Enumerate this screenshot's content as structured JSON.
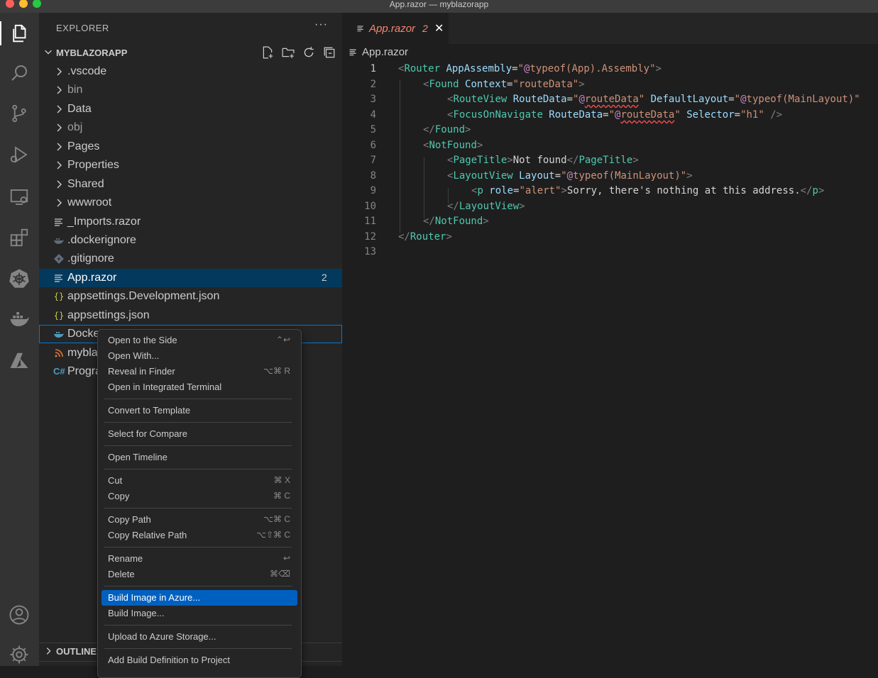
{
  "window": {
    "title": "App.razor — myblazorapp"
  },
  "explorer": {
    "title": "EXPLORER",
    "more": "···",
    "section_title": "MYBLAZORAPP",
    "items": [
      {
        "label": "vscode_dir",
        "text": ".vscode",
        "type": "folder"
      },
      {
        "label": "bin",
        "text": "bin",
        "type": "folder"
      },
      {
        "label": "data",
        "text": "Data",
        "type": "folder"
      },
      {
        "label": "obj",
        "text": "obj",
        "type": "folder"
      },
      {
        "label": "pages",
        "text": "Pages",
        "type": "folder"
      },
      {
        "label": "properties",
        "text": "Properties",
        "type": "folder"
      },
      {
        "label": "shared",
        "text": "Shared",
        "type": "folder"
      },
      {
        "label": "wwwroot",
        "text": "wwwroot",
        "type": "folder"
      },
      {
        "label": "imports",
        "text": "_Imports.razor",
        "type": "file"
      },
      {
        "label": "dockerignore",
        "text": ".dockerignore",
        "type": "file"
      },
      {
        "label": "gitignore",
        "text": ".gitignore",
        "type": "file"
      },
      {
        "label": "app",
        "text": "App.razor",
        "type": "file",
        "badge": "2"
      },
      {
        "label": "appsettings-dev",
        "text": "appsettings.Development.json",
        "type": "file"
      },
      {
        "label": "appsettings",
        "text": "appsettings.json",
        "type": "file"
      },
      {
        "label": "dockerfile",
        "text": "Docke",
        "type": "file"
      },
      {
        "label": "csproj",
        "text": "mybla",
        "type": "file"
      },
      {
        "label": "program",
        "text": "Progra",
        "type": "file"
      }
    ],
    "outline_title": "OUTLINE"
  },
  "editor": {
    "tab_label": "App.razor",
    "tab_problems": "2",
    "tab_close": "✕",
    "breadcrumb": "App.razor",
    "lines": [
      "1",
      "2",
      "3",
      "4",
      "5",
      "6",
      "7",
      "8",
      "9",
      "10",
      "11",
      "12",
      "13"
    ],
    "code": {
      "l1": [
        "<",
        "Router",
        " AppAssembly",
        "=",
        "\"",
        "@",
        "typeof(App).Assembly",
        "\"",
        ">"
      ],
      "l2": [
        "<",
        "Found",
        " Context",
        "=",
        "\"routeData\"",
        ">"
      ],
      "l3": [
        "<",
        "RouteView",
        " RouteData",
        "=",
        "\"",
        "@",
        "routeData",
        "\"",
        " DefaultLayout",
        "=",
        "\"",
        "@",
        "typeof(MainLayout)",
        "\""
      ],
      "l4": [
        "<",
        "FocusOnNavigate",
        " RouteData",
        "=",
        "\"",
        "@",
        "routeData",
        "\"",
        " Selector",
        "=",
        "\"h1\"",
        " />"
      ],
      "l5": [
        "</",
        "Found",
        ">"
      ],
      "l6": [
        "<",
        "NotFound",
        ">"
      ],
      "l7": [
        "<",
        "PageTitle",
        ">",
        "Not found",
        "</",
        "PageTitle",
        ">"
      ],
      "l8": [
        "<",
        "LayoutView",
        " Layout",
        "=",
        "\"",
        "@",
        "typeof(MainLayout)",
        "\"",
        ">"
      ],
      "l9": [
        "<",
        "p",
        " role",
        "=",
        "\"alert\"",
        ">",
        "Sorry, there's nothing at this address.",
        "</",
        "p",
        ">"
      ],
      "l10": [
        "</",
        "LayoutView",
        ">"
      ],
      "l11": [
        "</",
        "NotFound",
        ">"
      ],
      "l12": [
        "</",
        "Router",
        ">"
      ]
    }
  },
  "context_menu": {
    "items": [
      {
        "label": "Open to the Side",
        "key": "⌃↩"
      },
      {
        "label": "Open With...",
        "key": ""
      },
      {
        "label": "Reveal in Finder",
        "key": "⌥⌘ R"
      },
      {
        "label": "Open in Integrated Terminal",
        "key": ""
      },
      {
        "label": "Convert to Template",
        "key": ""
      },
      {
        "label": "Select for Compare",
        "key": ""
      },
      {
        "label": "Open Timeline",
        "key": ""
      },
      {
        "label": "Cut",
        "key": "⌘ X"
      },
      {
        "label": "Copy",
        "key": "⌘ C"
      },
      {
        "label": "Copy Path",
        "key": "⌥⌘ C"
      },
      {
        "label": "Copy Relative Path",
        "key": "⌥⇧⌘ C"
      },
      {
        "label": "Rename",
        "key": "↩"
      },
      {
        "label": "Delete",
        "key": "⌘⌫"
      },
      {
        "label": "Build Image in Azure...",
        "key": ""
      },
      {
        "label": "Build Image...",
        "key": ""
      },
      {
        "label": "Upload to Azure Storage...",
        "key": ""
      },
      {
        "label": "Add Build Definition to Project",
        "key": ""
      }
    ]
  },
  "colors": {
    "accent": "#0060c0",
    "selection": "#04395e",
    "error": "#f48771",
    "tag": "#4ec9b0",
    "attr": "#9cdcfe",
    "string": "#ce9178",
    "razor": "#c586c0"
  },
  "activity_icons": [
    "files-icon",
    "search-icon",
    "source-control-icon",
    "run-debug-icon",
    "remote-explorer-icon",
    "extensions-icon",
    "kubernetes-icon",
    "docker-icon",
    "azure-icon",
    "account-icon",
    "settings-gear-icon"
  ]
}
